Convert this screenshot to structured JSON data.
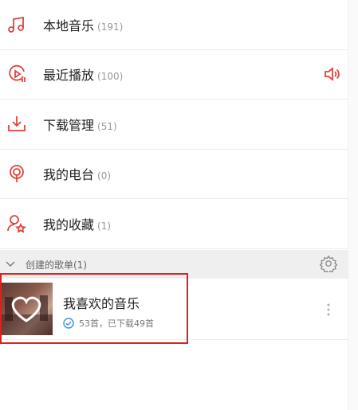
{
  "menu": [
    {
      "label": "本地音乐",
      "count": "(191)",
      "icon": "music-note-icon"
    },
    {
      "label": "最近播放",
      "count": "(100)",
      "icon": "recent-play-icon",
      "trailing_icon": "speaker-icon"
    },
    {
      "label": "下载管理",
      "count": "(51)",
      "icon": "download-icon"
    },
    {
      "label": "我的电台",
      "count": "(0)",
      "icon": "radio-icon"
    },
    {
      "label": "我的收藏",
      "count": "(1)",
      "icon": "user-star-icon"
    }
  ],
  "section": {
    "title": "创建的歌单(1)",
    "chevron": "chevron-down-icon",
    "gear": "gear-icon"
  },
  "playlist": {
    "title": "我喜欢的音乐",
    "subtitle": "53首，已下载49首",
    "cover_icon": "heart-icon",
    "status_icon": "check-circle-icon",
    "more_icon": "more-vertical-icon"
  },
  "colors": {
    "accent": "#e0443b",
    "blue": "#3d8fe0",
    "section_bg": "#efefef",
    "highlight": "#e21f1f"
  }
}
